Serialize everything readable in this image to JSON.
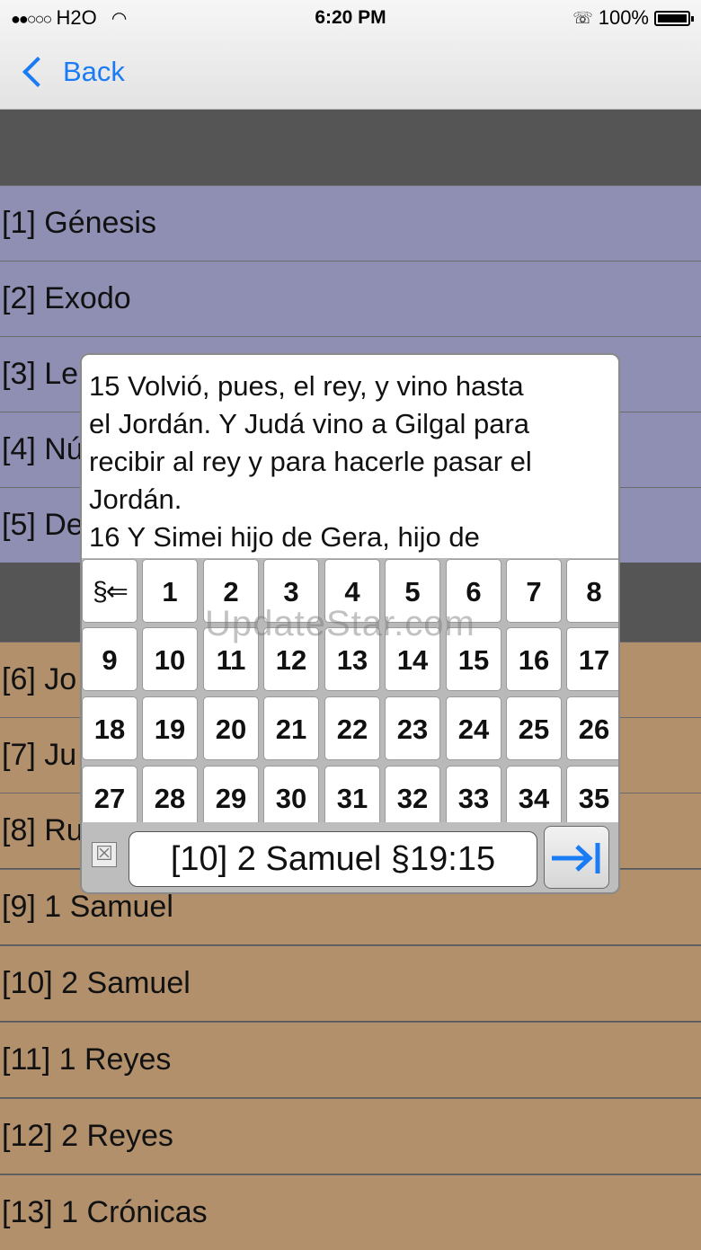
{
  "status": {
    "carrier": "H2O",
    "time": "6:20 PM",
    "battery_pct": "100%",
    "battery_level": 1.0
  },
  "nav": {
    "back_label": "Back"
  },
  "books_top": [
    "[1] Génesis",
    "[2] Exodo",
    "[3] Le",
    "[4] Nú",
    "[5] De"
  ],
  "books_bottom": [
    "[6] Jo",
    "[7] Ju",
    "[8] Ru",
    "[9] 1 Samuel",
    "[10] 2 Samuel",
    "[11] 1 Reyes",
    "[12] 2 Reyes",
    "[13] 1 Crónicas"
  ],
  "popup": {
    "verse_lines": [
      "15 Volvió, pues, el rey, y vino hasta",
      "el Jordán. Y Judá vino a Gilgal para",
      "recibir al rey y para hacerle pasar el",
      "Jordán.",
      "16 Y Simei hijo de Gera, hijo de"
    ],
    "section_key": "§⇐",
    "number_keys": [
      "1",
      "2",
      "3",
      "4",
      "5",
      "6",
      "7",
      "8",
      "9",
      "10",
      "11",
      "12",
      "13",
      "14",
      "15",
      "16",
      "17",
      "18",
      "19",
      "20",
      "21",
      "22",
      "23",
      "24",
      "25",
      "26",
      "27",
      "28",
      "29",
      "30",
      "31",
      "32",
      "33",
      "34",
      "35"
    ],
    "clear_glyph": "☒",
    "reference": "[10] 2 Samuel §19:15"
  },
  "watermark": "UpdateStar.com",
  "colors": {
    "accent": "#1a7cf5",
    "ot_law": "#8f8fb4",
    "ot_history": "#b2906c"
  }
}
